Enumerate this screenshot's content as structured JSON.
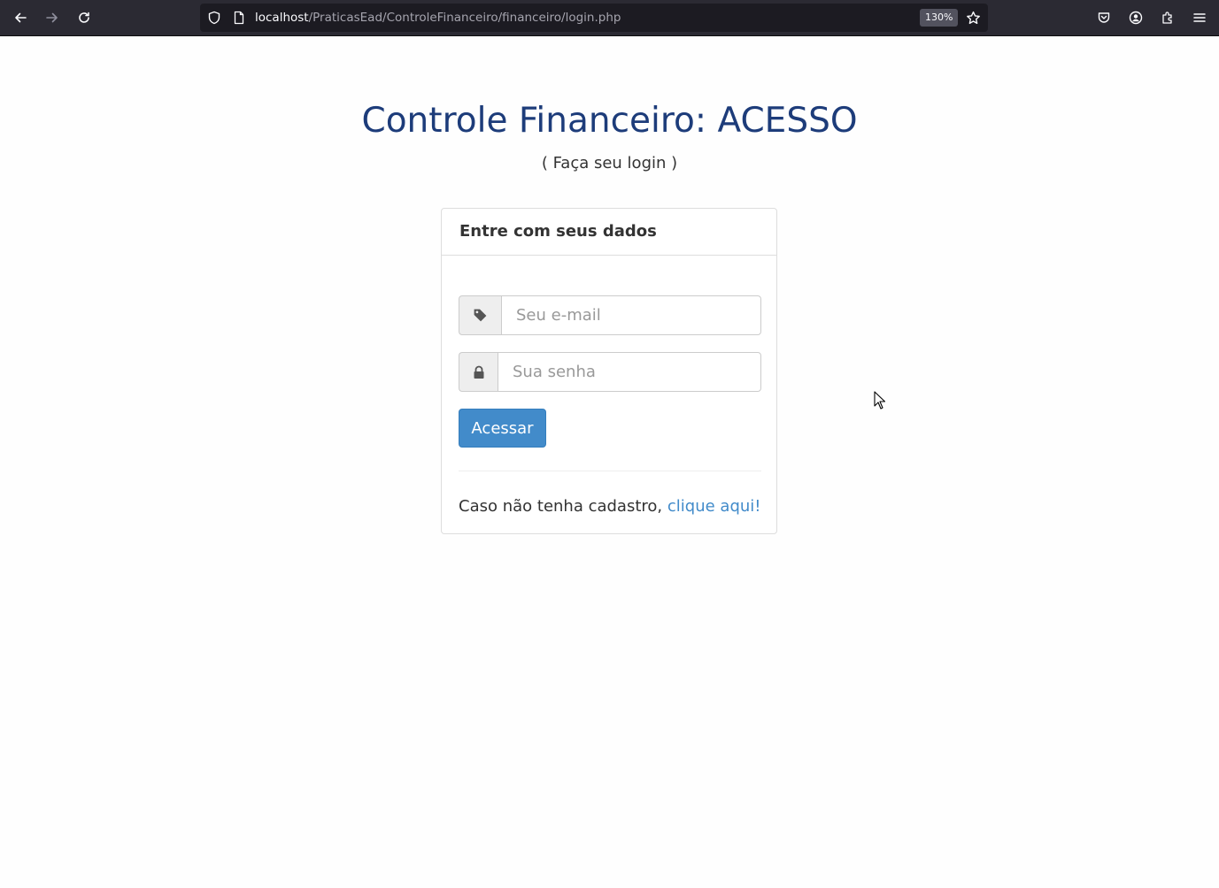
{
  "browser": {
    "url_host": "localhost",
    "url_path": "/PraticasEad/ControleFinanceiro/financeiro/login.php",
    "zoom": "130%",
    "icons": {
      "back": "arrow-left-icon",
      "forward": "arrow-right-icon",
      "reload": "reload-icon",
      "tracking": "shield-icon",
      "page": "page-icon",
      "bookmark": "star-icon",
      "pocket": "pocket-icon",
      "account": "account-icon",
      "extensions": "puzzle-icon",
      "menu": "hamburger-icon"
    }
  },
  "page": {
    "title": "Controle Financeiro: ACESSO",
    "subtitle": "( Faça seu login )"
  },
  "panel": {
    "heading": "Entre com seus dados",
    "email": {
      "placeholder": "Seu e-mail",
      "value": "",
      "icon": "tag-icon"
    },
    "password": {
      "placeholder": "Sua senha",
      "value": "",
      "icon": "lock-icon"
    },
    "submit_label": "Acessar",
    "signup_text": "Caso não tenha cadastro,",
    "signup_link": "clique aqui!"
  },
  "colors": {
    "title": "#1d3c7a",
    "primary": "#428bca",
    "chrome": "#2b2a33",
    "urlbar": "#1c1b22"
  }
}
